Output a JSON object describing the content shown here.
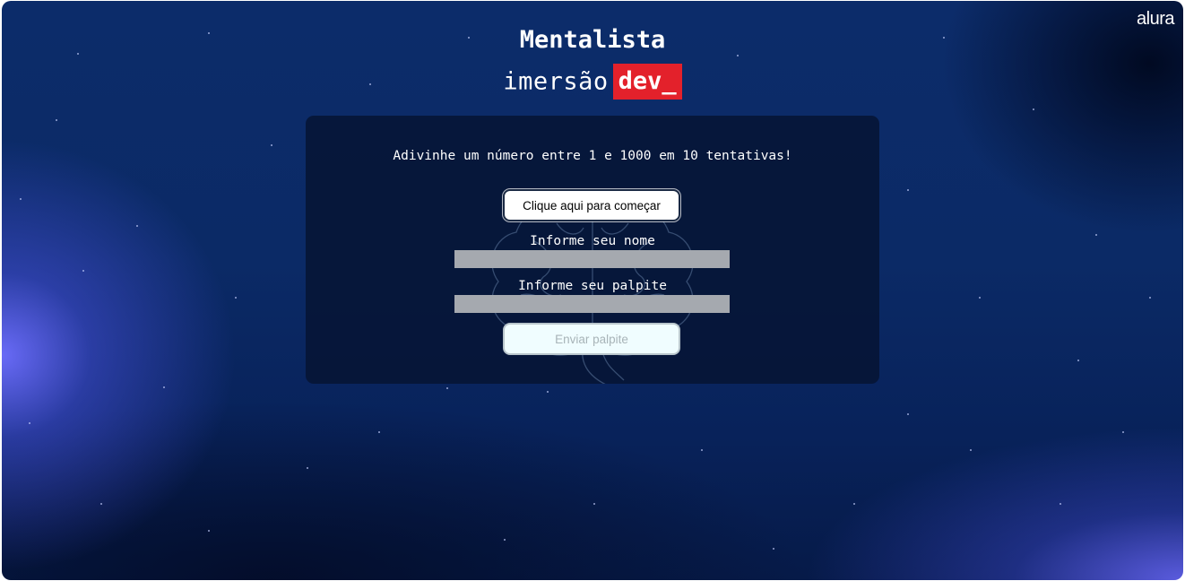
{
  "brand": {
    "logo": "alura",
    "title": "Mentalista",
    "subtitle_light": "imersão",
    "subtitle_badge": "dev_",
    "badge_color": "#e3212b"
  },
  "game": {
    "instructions": "Adivinhe um número entre 1 e 1000 em 10 tentativas!",
    "start_button": "Clique aqui para começar",
    "name_label": "Informe seu nome",
    "name_value": "",
    "guess_label": "Informe seu palpite",
    "guess_value": "",
    "send_button": "Enviar palpite"
  },
  "icons": {
    "background_art": "brain-icon"
  }
}
